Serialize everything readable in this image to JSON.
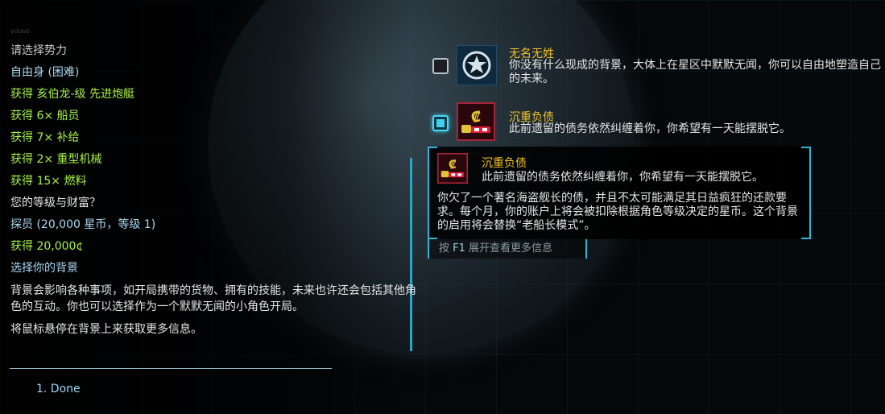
{
  "left": {
    "header_faded": "vouvs",
    "prompt_faction": "请选择势力",
    "faction_choice": "自由身 (困难)",
    "rewards": [
      "获得 亥伯龙-级 先进炮艇",
      "获得 6× 船员",
      "获得 7× 补给",
      "获得 2× 重型机械",
      "获得 15× 燃料"
    ],
    "prompt_level": "您的等级与财富？",
    "level_choice": "探员 (20,000 星币，等级 1)",
    "level_reward": "获得 20,000¢",
    "prompt_background": "选择你的背景",
    "background_desc": "背景会影响各种事项，如开局携带的货物、拥有的技能，未来也许还会包括其他角色的互动。你也可以选择作为一个默默无闻的小角色开局。",
    "hover_hint": "将鼠标悬停在背景上来获取更多信息。",
    "done_option": "1. Done"
  },
  "options": [
    {
      "title": "无名无姓",
      "desc": "你没有什么现成的背景，大体上在星区中默默无闻，你可以自由地塑造自己的未来。",
      "icon": "star-emblem-icon",
      "checked": false
    },
    {
      "title": "沉重负债",
      "desc": "此前遗留的债务依然纠缠着你，你希望有一天能摆脱它。",
      "icon": "debt-icon",
      "checked": true
    }
  ],
  "tooltip": {
    "title": "沉重负债",
    "subtitle": "此前遗留的债务依然纠缠着你，你希望有一天能摆脱它。",
    "body": "你欠了一个著名海盗舰长的债，并且不太可能满足其日益疯狂的还款要求。每个月，你的账户上将会被扣除根据角色等级决定的星币。这个背景的启用将会替换“老船长模式”。",
    "expand_hint_prefix": "按 ",
    "expand_hint_key": "F1",
    "expand_hint_suffix": " 展开查看更多信息"
  },
  "colors": {
    "accent_cyan": "#2fb5d6",
    "reward_green": "#a6f04a",
    "title_gold": "#f2c22a"
  }
}
